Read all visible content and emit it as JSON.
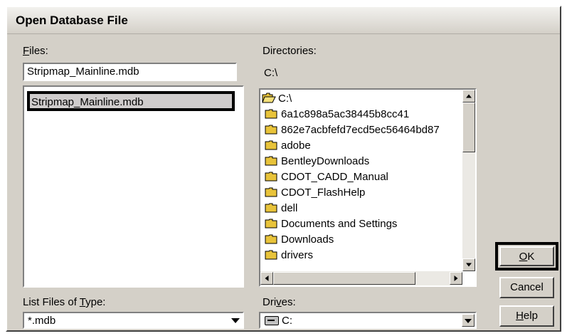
{
  "window": {
    "title": "Open Database File"
  },
  "files": {
    "label_prefix": "F",
    "label_rest": "iles:",
    "filename_value": "Stripmap_Mainline.mdb",
    "items": [
      "Stripmap_Mainline.mdb"
    ]
  },
  "directories": {
    "label": "Directories:",
    "current_path": "C:\\",
    "items": [
      "C:\\",
      "6a1c898a5ac38445b8cc41",
      "862e7acbfefd7ecd5ec56464bd87",
      "adobe",
      "BentleyDownloads",
      "CDOT_CADD_Manual",
      "CDOT_FlashHelp",
      "dell",
      "Documents and Settings",
      "Downloads",
      "drivers"
    ]
  },
  "type": {
    "label_prefix": "List Files of ",
    "label_u": "T",
    "label_rest": "ype:",
    "value": "*.mdb"
  },
  "drives": {
    "label_prefix": "Dri",
    "label_u": "v",
    "label_rest": "es:",
    "value": "C:"
  },
  "buttons": {
    "ok_u": "O",
    "ok_rest": "K",
    "cancel": "Cancel",
    "help_u": "H",
    "help_rest": "elp"
  },
  "colors": {
    "folder": "#e8c33a",
    "dialog": "#d4d0c8",
    "highlight_border": "#000000"
  },
  "icons": {
    "open_folder": "open-folder-icon",
    "folder": "folder-icon",
    "drive": "drive-icon"
  }
}
